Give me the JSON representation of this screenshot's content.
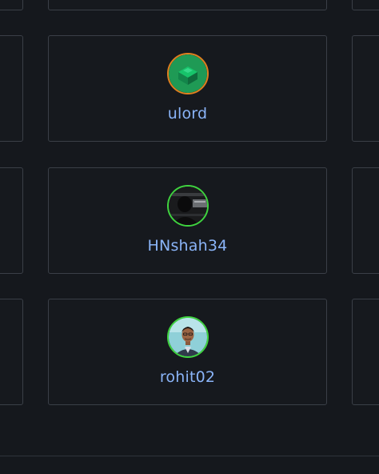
{
  "users": [
    {
      "username": "ulord",
      "ring_color": "#e0801f",
      "avatar_icon": "green-cube-avatar-icon"
    },
    {
      "username": "HNshah34",
      "ring_color": "#3fd43f",
      "avatar_icon": "dark-photo-avatar-icon"
    },
    {
      "username": "rohit02",
      "ring_color": "#3fd43f",
      "avatar_icon": "person-photo-avatar-icon"
    }
  ]
}
